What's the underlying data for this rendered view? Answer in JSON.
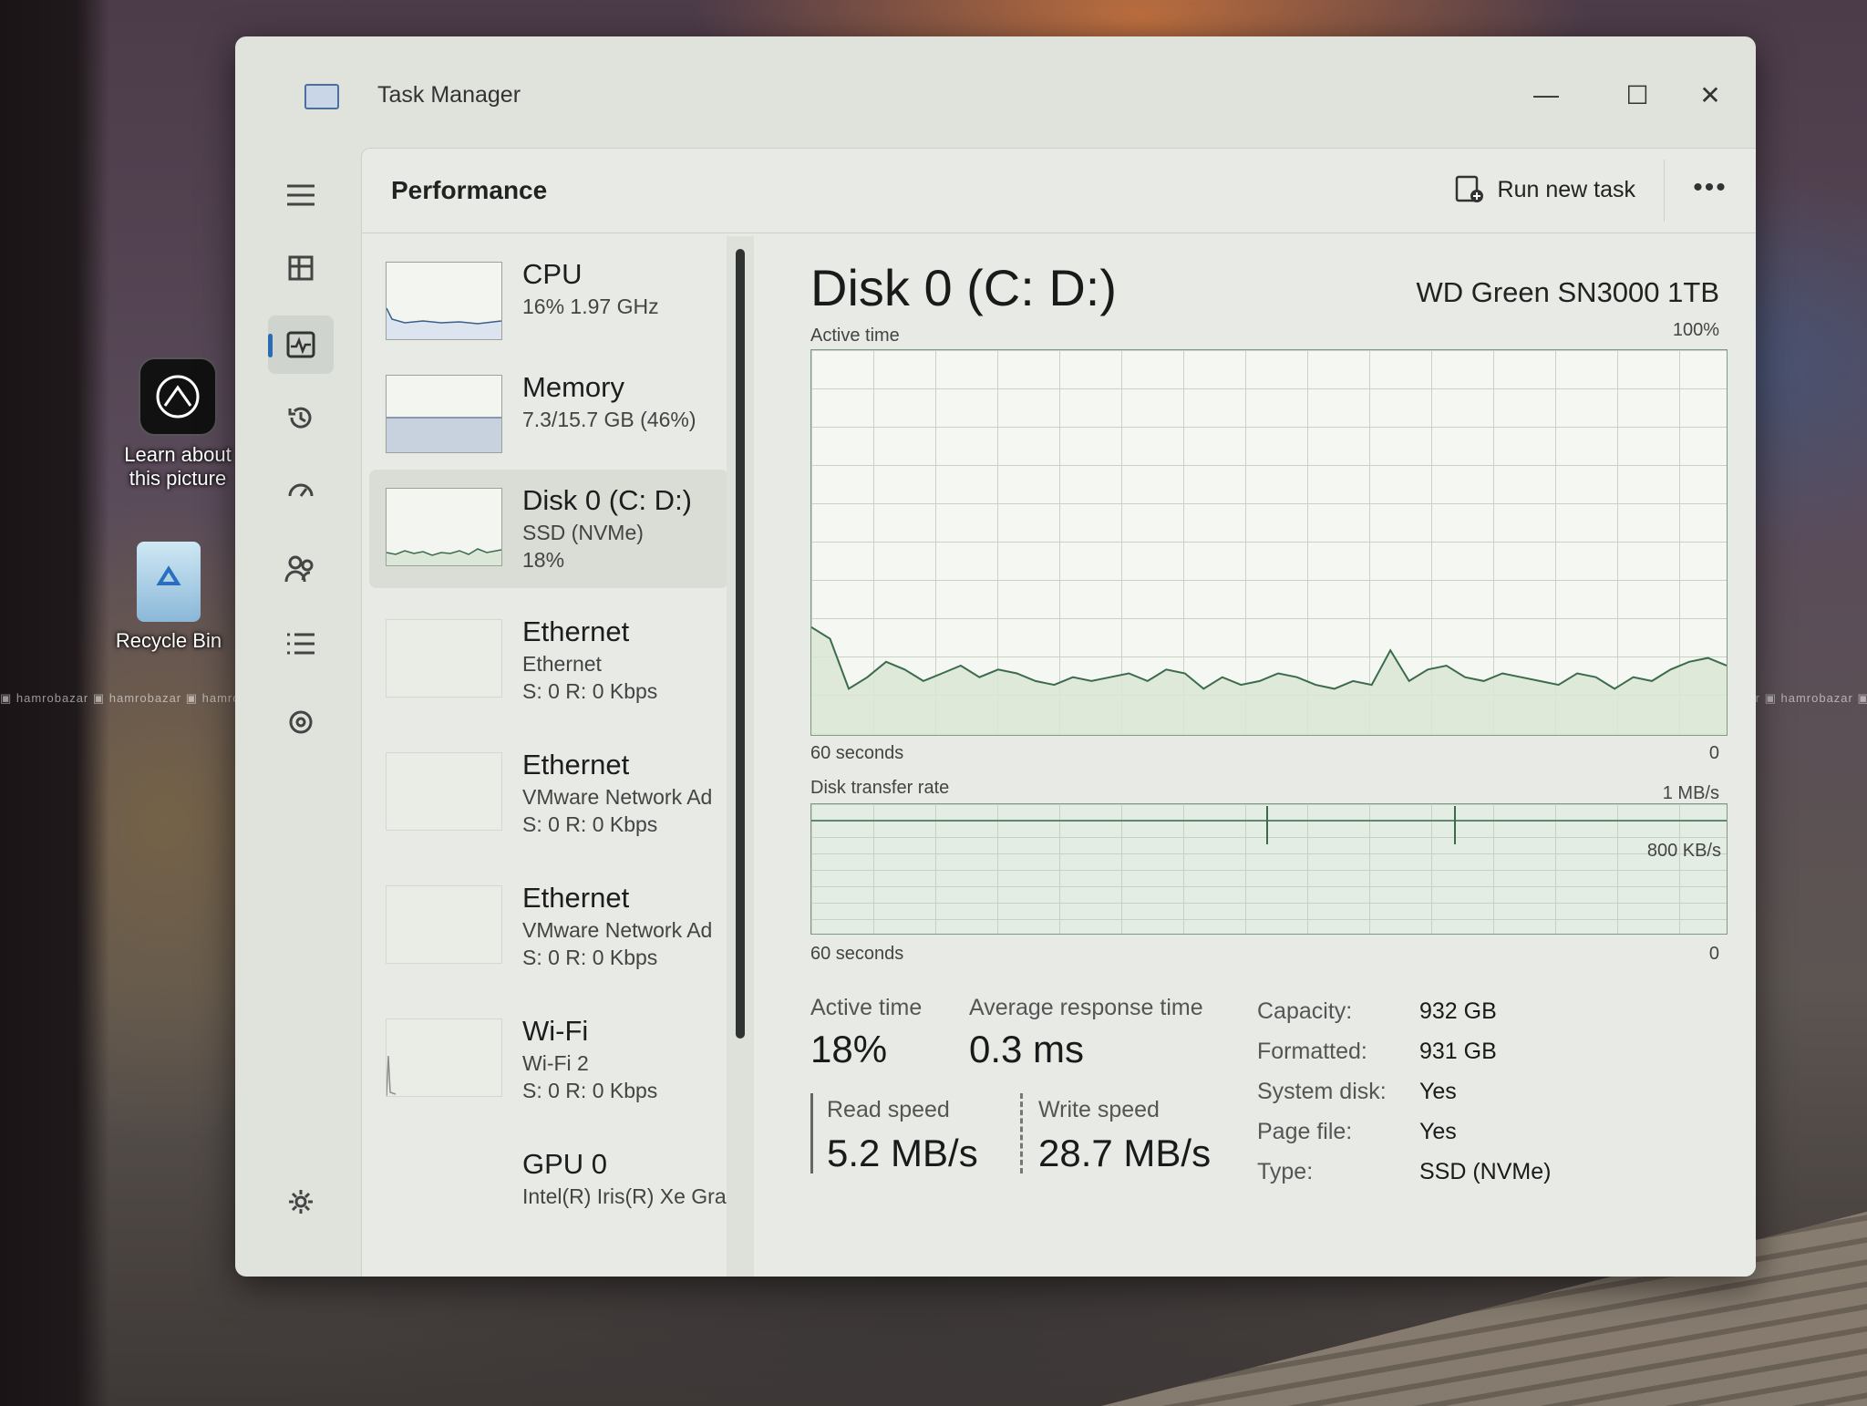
{
  "desktop": {
    "icons": [
      {
        "label_line1": "Learn about",
        "label_line2": "this picture",
        "icon": "camera-aperture-icon"
      },
      {
        "label": "Recycle Bin",
        "icon": "recycle-bin-icon"
      }
    ],
    "watermark": "hamrobazar"
  },
  "window": {
    "title": "Task Manager",
    "controls": {
      "minimize": "—",
      "maximize": "☐",
      "close": "✕"
    }
  },
  "nav": {
    "items": [
      {
        "name": "menu",
        "icon": "hamburger-icon"
      },
      {
        "name": "processes",
        "icon": "processes-icon"
      },
      {
        "name": "performance",
        "icon": "performance-icon",
        "active": true
      },
      {
        "name": "app-history",
        "icon": "history-icon"
      },
      {
        "name": "startup-apps",
        "icon": "startup-icon"
      },
      {
        "name": "users",
        "icon": "users-icon"
      },
      {
        "name": "details",
        "icon": "details-list-icon"
      },
      {
        "name": "services",
        "icon": "services-icon"
      },
      {
        "name": "settings",
        "icon": "gear-icon"
      }
    ]
  },
  "header": {
    "title": "Performance",
    "run_new_task": "Run new task",
    "more": "•••"
  },
  "devices": [
    {
      "name": "CPU",
      "line2": "16%  1.97 GHz",
      "line3": ""
    },
    {
      "name": "Memory",
      "line2": "7.3/15.7 GB (46%)",
      "line3": ""
    },
    {
      "name": "Disk 0 (C: D:)",
      "line2": "SSD (NVMe)",
      "line3": "18%",
      "selected": true
    },
    {
      "name": "Ethernet",
      "line2": "Ethernet",
      "line3": "S: 0 R: 0 Kbps"
    },
    {
      "name": "Ethernet",
      "line2": "VMware Network Ad",
      "line3": "S: 0 R: 0 Kbps"
    },
    {
      "name": "Ethernet",
      "line2": "VMware Network Ad",
      "line3": "S: 0 R: 0 Kbps"
    },
    {
      "name": "Wi-Fi",
      "line2": "Wi-Fi 2",
      "line3": "S: 0 R: 0 Kbps"
    },
    {
      "name": "GPU 0",
      "line2": "Intel(R) Iris(R) Xe Gra",
      "line3": ""
    }
  ],
  "detail": {
    "title": "Disk 0 (C: D:)",
    "model": "WD Green SN3000 1TB",
    "active_graph": {
      "label": "Active time",
      "max": "100%",
      "xlabel": "60 seconds",
      "min": "0"
    },
    "rate_graph": {
      "label": "Disk transfer rate",
      "max": "1 MB/s",
      "mid": "800 KB/s",
      "xlabel": "60 seconds",
      "min": "0"
    },
    "stats": {
      "active_time_label": "Active time",
      "active_time_value": "18%",
      "avg_resp_label": "Average response time",
      "avg_resp_value": "0.3 ms",
      "read_label": "Read speed",
      "read_value": "5.2 MB/s",
      "write_label": "Write speed",
      "write_value": "28.7 MB/s"
    },
    "properties": [
      {
        "label": "Capacity:",
        "value": "932 GB"
      },
      {
        "label": "Formatted:",
        "value": "931 GB"
      },
      {
        "label": "System disk:",
        "value": "Yes"
      },
      {
        "label": "Page file:",
        "value": "Yes"
      },
      {
        "label": "Type:",
        "value": "SSD (NVMe)"
      }
    ]
  },
  "chart_data": {
    "type": "area",
    "title": "Active time",
    "ylim": [
      0,
      100
    ],
    "series": [
      {
        "name": "Active time",
        "values": [
          28,
          25,
          12,
          15,
          19,
          17,
          14,
          16,
          18,
          15,
          17,
          16,
          14,
          13,
          15,
          14,
          15,
          16,
          14,
          17,
          16,
          12,
          15,
          13,
          14,
          16,
          15,
          13,
          12,
          14,
          13,
          22,
          14,
          17,
          18,
          15,
          14,
          16,
          15,
          14,
          13,
          16,
          15,
          12,
          15,
          14,
          17,
          19,
          20,
          18
        ]
      }
    ],
    "colors": {
      "line": "#3c6b4c",
      "fill": "#d9e6d6"
    }
  }
}
